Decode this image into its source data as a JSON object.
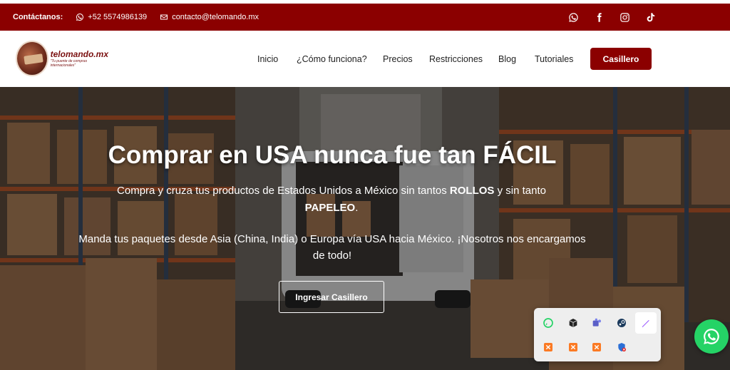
{
  "topbar": {
    "contact_label": "Contáctanos:",
    "phone": "+52 5574986139",
    "email": "contacto@telomando.mx",
    "socials": [
      "whatsapp-icon",
      "facebook-icon",
      "instagram-icon",
      "tiktok-icon"
    ]
  },
  "header": {
    "logo_name": "telomando.mx",
    "logo_tagline": "\"Tu puente de compras internacionales\"",
    "nav": [
      "Inicio",
      "¿Cómo funciona?",
      "Precios",
      "Restricciones",
      "Blog",
      "Tutoriales"
    ],
    "cta": "Casillero"
  },
  "hero": {
    "title_prefix": "Comprar en USA nunca fue tan ",
    "title_emph": "FÁCIL",
    "sub_a": "Compra y cruza tus productos de Estados Unidos a México sin tantos ",
    "sub_b": "ROLLOS",
    "sub_c": " y sin tanto",
    "sub_d": "PAPELEO",
    "sub_e": ".",
    "sub2": "Manda tus paquetes desde Asia (China, India) o Europa vía USA hacia México. ¡Nosotros nos encargamos de todo!",
    "button": "Ingresar Casillero"
  },
  "tray": {
    "icons": [
      "whatsapp-icon",
      "box-icon",
      "teams-icon",
      "steam-icon",
      "pen-icon",
      "xampp-icon",
      "xampp-icon",
      "xampp-icon",
      "network-error-icon"
    ]
  },
  "colors": {
    "brand": "#8b0000",
    "whatsapp": "#25d366"
  }
}
